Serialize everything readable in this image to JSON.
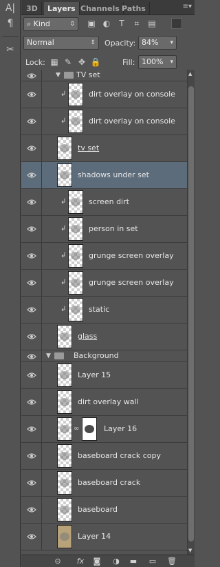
{
  "toolstrip": {
    "items": [
      "A|",
      "¶"
    ],
    "scissors": "✂"
  },
  "tabs": [
    {
      "label": "3D",
      "active": false
    },
    {
      "label": "Layers",
      "active": true
    },
    {
      "label": "Channels",
      "active": false
    },
    {
      "label": "Paths",
      "active": false
    }
  ],
  "filter": {
    "kind_label": "Kind"
  },
  "blend": {
    "mode": "Normal",
    "opacity_label": "Opacity:",
    "opacity": "84%"
  },
  "lock": {
    "label": "Lock:",
    "fill_label": "Fill:",
    "fill": "100%"
  },
  "layers": [
    {
      "name": "TV set",
      "group": true
    },
    {
      "name": "dirt overlay on console",
      "clipped": true
    },
    {
      "name": "dirt overlay on console",
      "clipped": true
    },
    {
      "name": "tv set",
      "underline": true
    },
    {
      "name": "shadows under set",
      "selected": true
    },
    {
      "name": "screen dirt",
      "clipped": true
    },
    {
      "name": "person in set",
      "clipped": true
    },
    {
      "name": "grunge screen overlay",
      "clipped": true
    },
    {
      "name": "grunge screen overlay",
      "clipped": true
    },
    {
      "name": "static",
      "clipped": true
    },
    {
      "name": "glass",
      "underline": true
    },
    {
      "name": "Background",
      "group": true,
      "root": true
    },
    {
      "name": "Layer 15"
    },
    {
      "name": "dirt overlay wall"
    },
    {
      "name": "Layer 16",
      "masked": true
    },
    {
      "name": "baseboard crack copy"
    },
    {
      "name": "baseboard crack"
    },
    {
      "name": "baseboard"
    },
    {
      "name": "Layer 14"
    }
  ],
  "bottom_icons": [
    "link-icon",
    "fx-icon",
    "mask-icon",
    "adjustment-icon",
    "folder-icon",
    "new-layer-icon",
    "trash-icon"
  ]
}
